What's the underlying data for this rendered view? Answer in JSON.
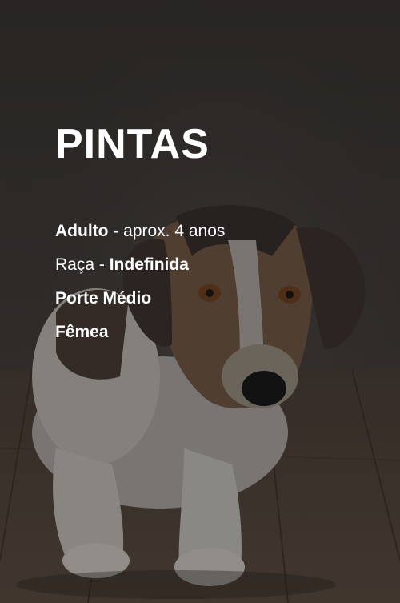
{
  "pet": {
    "name": "PINTAS",
    "age_label": "Adulto -",
    "age_value": "aprox. 4 anos",
    "breed_label": "Raça -",
    "breed_value": "Indefinida",
    "size": "Porte Médio",
    "sex": "Fêmea"
  },
  "photo": {
    "subject": "dog-photo"
  },
  "colors": {
    "background": "#2d2a27",
    "text": "#ffffff"
  }
}
